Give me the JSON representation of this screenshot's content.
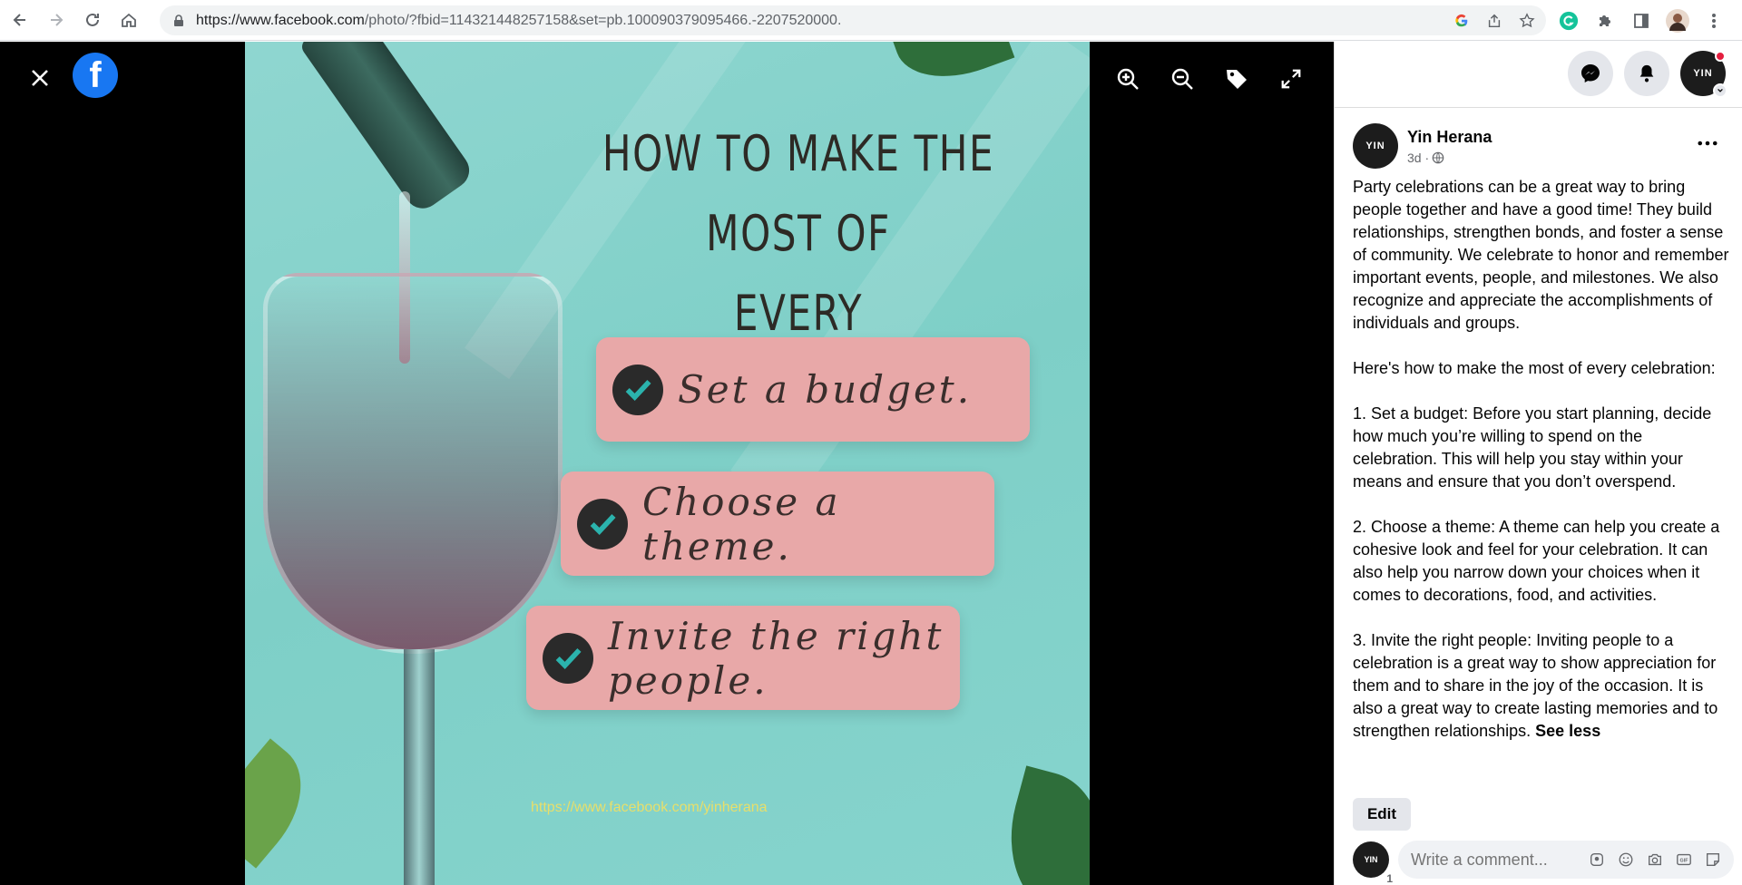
{
  "browser": {
    "url_host": "https://www.facebook.com",
    "url_path": "/photo/?fbid=114321448257158&set=pb.100090379095466.-2207520000."
  },
  "viewer": {
    "logo_letter": "f"
  },
  "photo": {
    "headline_line1": "HOW TO MAKE THE MOST OF",
    "headline_line2": "EVERY CELEBRATION",
    "items": [
      {
        "text": "Set a budget."
      },
      {
        "text": "Choose a theme."
      },
      {
        "text": "Invite the right people."
      }
    ],
    "url_text": "https://www.facebook.com/yinherana"
  },
  "post": {
    "author": "Yin Herana",
    "avatar_text": "YIN",
    "time": "3d ·",
    "paragraphs": [
      "Party celebrations can be a great way to bring people together and have a good time! They build relationships, strengthen bonds, and foster a sense of community. We celebrate to honor and remember important events, people, and milestones. We also recognize and appreciate the accomplishments of individuals and groups.",
      "Here's how to make the most of every celebration:",
      "1. Set a budget: Before you start planning, decide how much you’re willing to spend on the celebration. This will help you stay within your means and ensure that you don’t overspend.",
      "2. Choose a theme: A theme can help you create a cohesive look and feel for your celebration. It can also help you narrow down your choices when it comes to decorations, food, and activities."
    ],
    "last_paragraph": "3. Invite the right people: Inviting people to a celebration is a great way to show appreciation for them and to share in the joy of the occasion. It is also a great way to create lasting memories and to strengthen relationships.",
    "see_less": "See less",
    "edit_label": "Edit"
  },
  "comment": {
    "placeholder": "Write a comment...",
    "avatar_badge": "1"
  },
  "colors": {
    "facebook_blue": "#1877f2",
    "photo_teal": "#86d4cd",
    "card_pink": "#e8a8a8",
    "check_teal": "#2bb3ad",
    "notification_red": "#e41e3f"
  }
}
